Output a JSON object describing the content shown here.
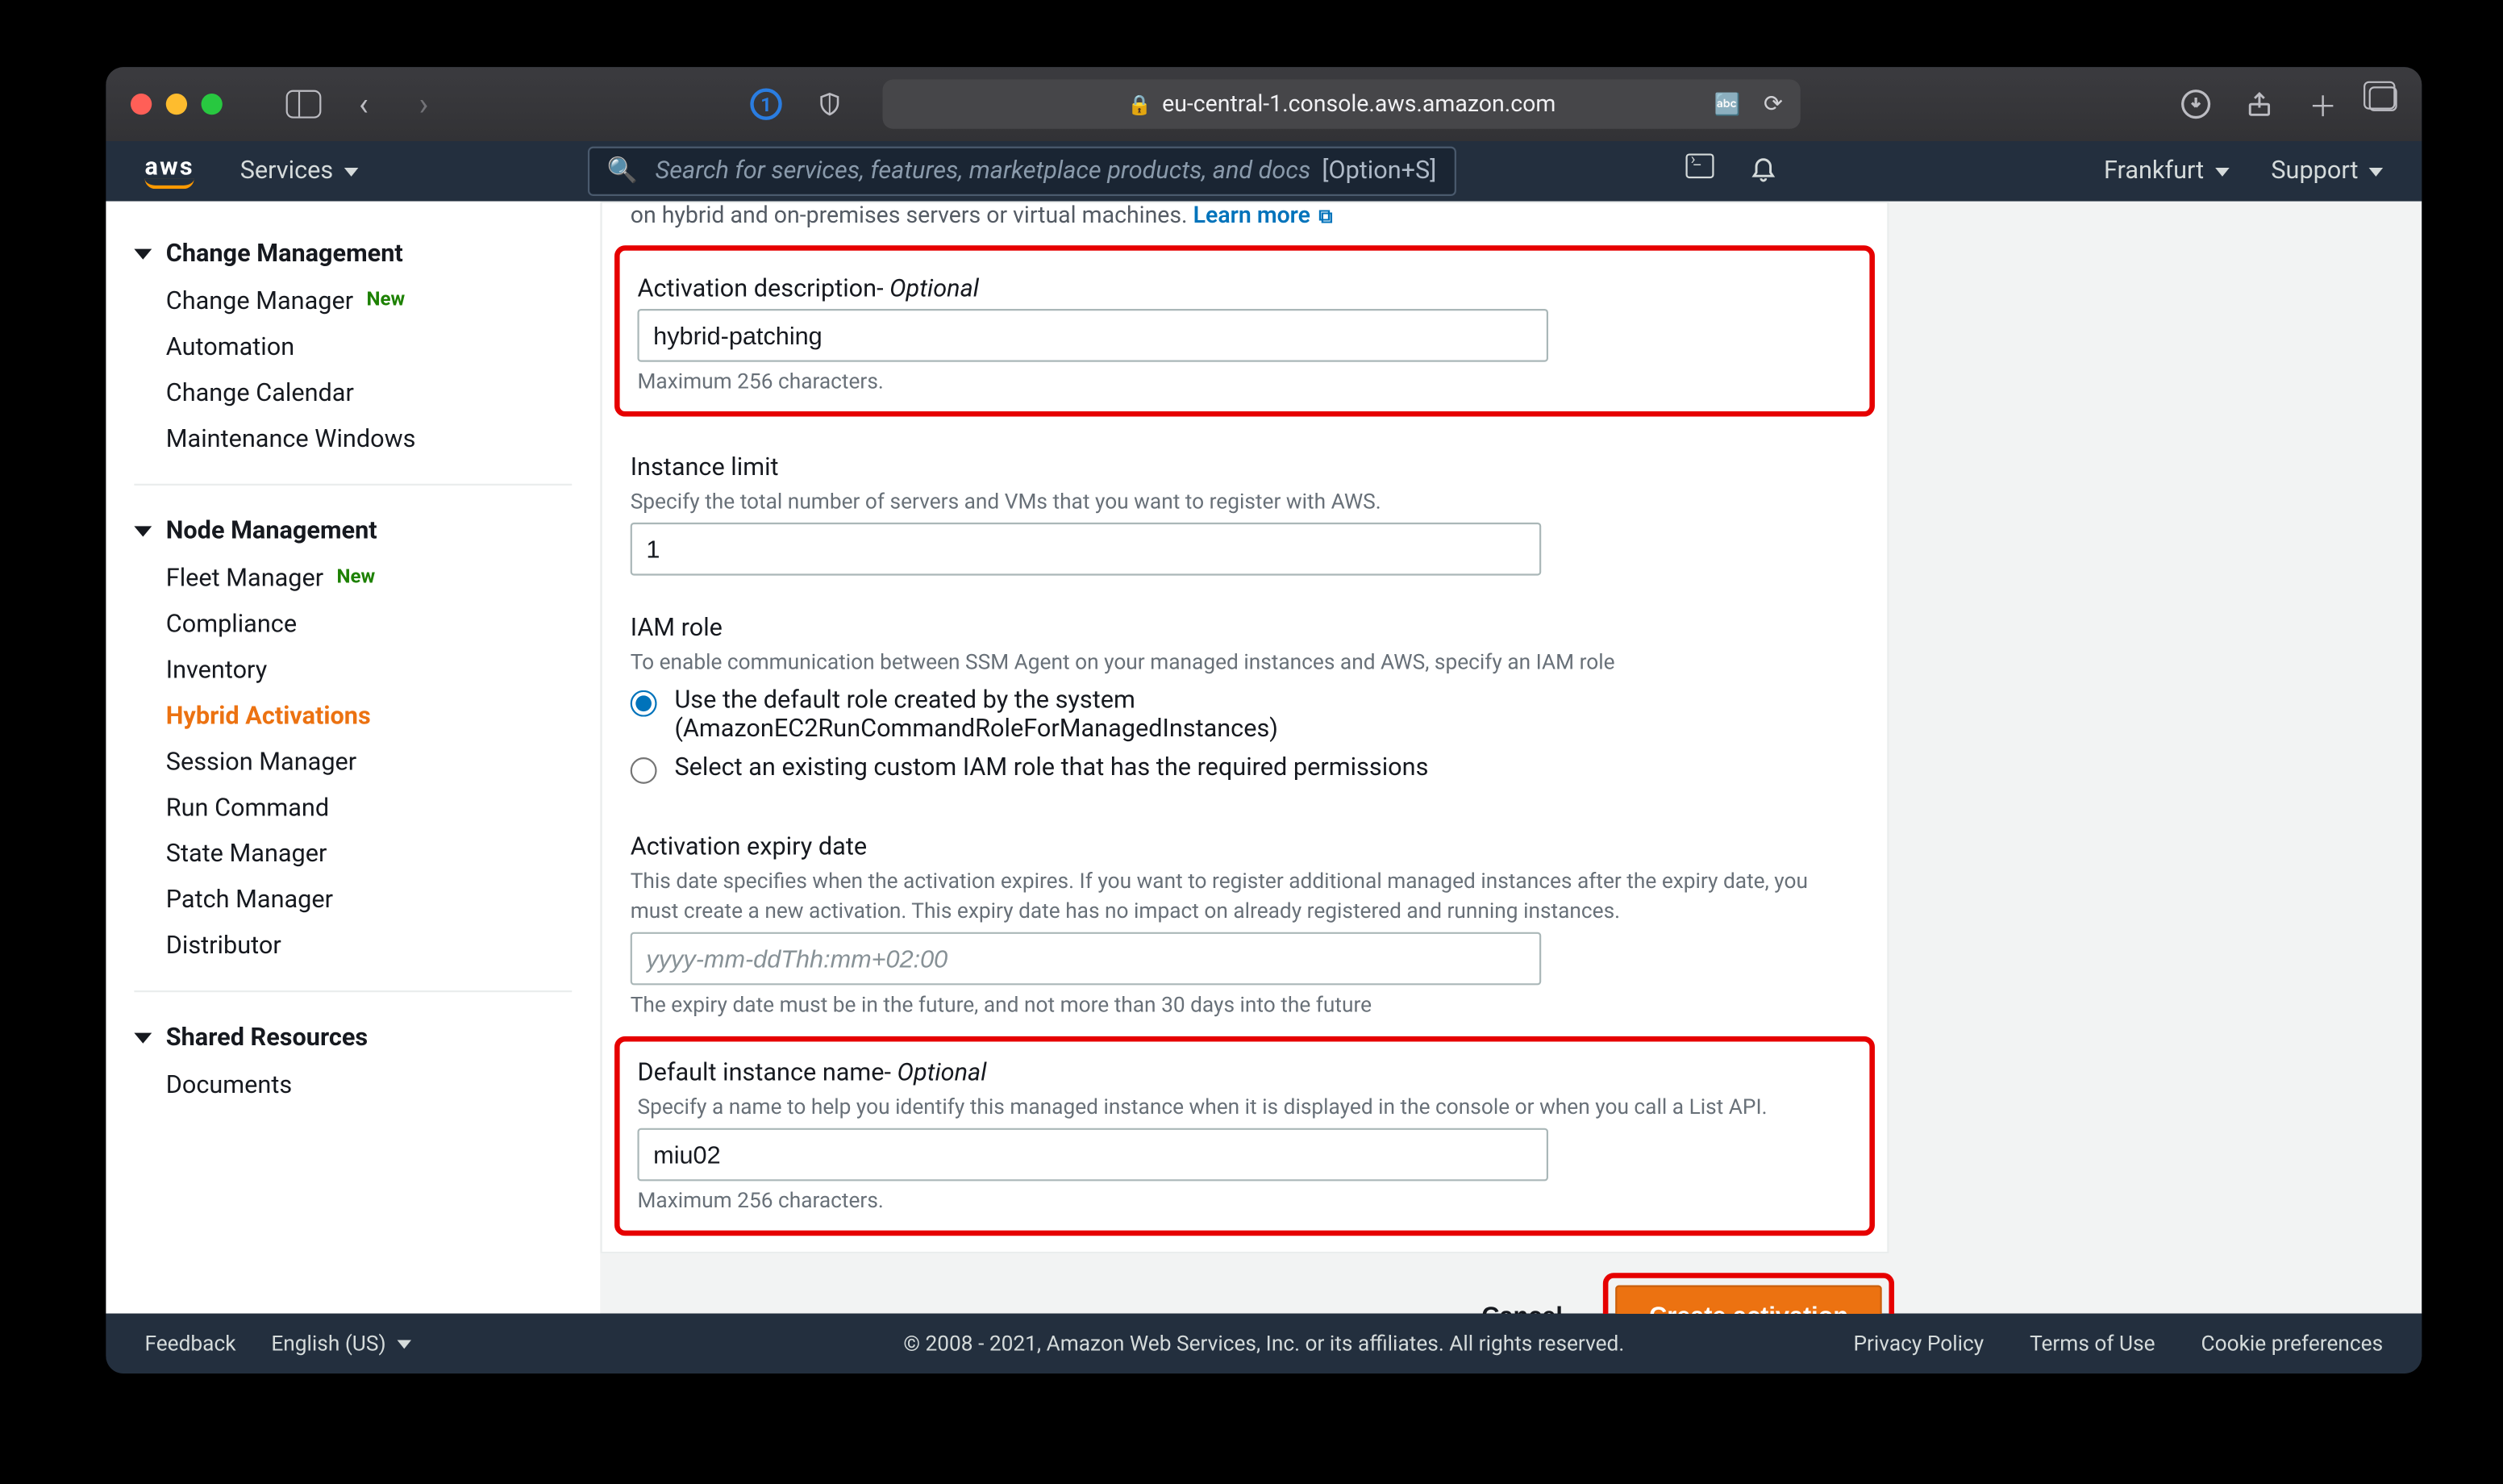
{
  "browser": {
    "url": "eu-central-1.console.aws.amazon.com"
  },
  "nav": {
    "services": "Services",
    "search_placeholder": "Search for services, features, marketplace products, and docs",
    "search_kb": "[Option+S]",
    "region": "Frankfurt",
    "support": "Support"
  },
  "sidebar": {
    "sections": [
      {
        "title": "Change Management",
        "items": [
          {
            "label": "Change Manager",
            "badge": "New"
          },
          {
            "label": "Automation"
          },
          {
            "label": "Change Calendar"
          },
          {
            "label": "Maintenance Windows"
          }
        ]
      },
      {
        "title": "Node Management",
        "items": [
          {
            "label": "Fleet Manager",
            "badge": "New"
          },
          {
            "label": "Compliance"
          },
          {
            "label": "Inventory"
          },
          {
            "label": "Hybrid Activations",
            "active": true
          },
          {
            "label": "Session Manager"
          },
          {
            "label": "Run Command"
          },
          {
            "label": "State Manager"
          },
          {
            "label": "Patch Manager"
          },
          {
            "label": "Distributor"
          }
        ]
      },
      {
        "title": "Shared Resources",
        "items": [
          {
            "label": "Documents"
          }
        ]
      }
    ]
  },
  "form": {
    "intro_tail": "on hybrid and on-premises servers or virtual machines.",
    "learn_more": "Learn more",
    "activation_desc": {
      "label": "Activation description-",
      "optional": " Optional",
      "value": "hybrid-patching",
      "hint": "Maximum 256 characters."
    },
    "instance_limit": {
      "label": "Instance limit",
      "help": "Specify the total number of servers and VMs that you want to register with AWS.",
      "value": "1"
    },
    "iam_role": {
      "label": "IAM role",
      "help": "To enable communication between SSM Agent on your managed instances and AWS, specify an IAM role",
      "opt1_line1": "Use the default role created by the system",
      "opt1_line2": "(AmazonEC2RunCommandRoleForManagedInstances)",
      "opt2": "Select an existing custom IAM role that has the required permissions"
    },
    "expiry": {
      "label": "Activation expiry date",
      "help": "This date specifies when the activation expires. If you want to register additional managed instances after the expiry date, you must create a new activation. This expiry date has no impact on already registered and running instances.",
      "placeholder": "yyyy-mm-ddThh:mm+02:00",
      "hint": "The expiry date must be in the future, and not more than 30 days into the future"
    },
    "default_name": {
      "label": "Default instance name-",
      "optional": " Optional",
      "help": "Specify a name to help you identify this managed instance when it is displayed in the console or when you call a List API.",
      "value": "miu02",
      "hint": "Maximum 256 characters."
    },
    "cancel": "Cancel",
    "submit": "Create activation"
  },
  "footer": {
    "feedback": "Feedback",
    "lang": "English (US)",
    "copy": "© 2008 - 2021, Amazon Web Services, Inc. or its affiliates. All rights reserved.",
    "links": [
      "Privacy Policy",
      "Terms of Use",
      "Cookie preferences"
    ]
  }
}
